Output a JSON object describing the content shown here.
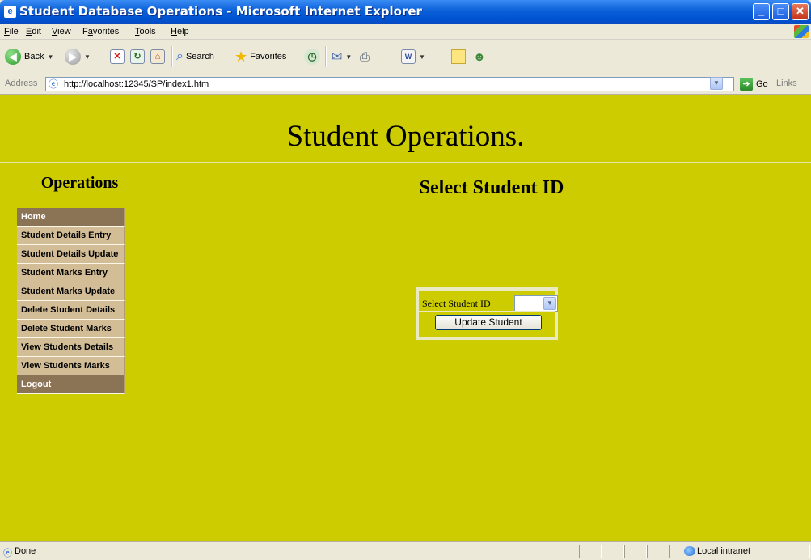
{
  "window": {
    "title": "Student Database Operations - Microsoft Internet Explorer",
    "controls": {
      "minimize": "_",
      "maximize": "□",
      "close": "X"
    }
  },
  "menu": [
    {
      "label": "File",
      "accel": "F",
      "rest": "ile"
    },
    {
      "label": "Edit",
      "accel": "E",
      "rest": "dit"
    },
    {
      "label": "View",
      "accel": "V",
      "rest": "iew"
    },
    {
      "label": "Favorites",
      "accel": "a",
      "pre": "F",
      "rest": "vorites"
    },
    {
      "label": "Tools",
      "accel": "T",
      "rest": "ools"
    },
    {
      "label": "Help",
      "accel": "H",
      "rest": "elp"
    }
  ],
  "toolbar": {
    "back_label": "Back",
    "search_label": "Search",
    "favorites_label": "Favorites"
  },
  "address": {
    "label": "Address",
    "url": "http://localhost:12345/SP/index1.htm",
    "go_label": "Go",
    "links_label": "Links"
  },
  "page": {
    "title": "Student Operations.",
    "sidebar_title": "Operations",
    "nav": [
      {
        "label": "Home",
        "style": "dark"
      },
      {
        "label": "Student Details Entry",
        "style": "light"
      },
      {
        "label": "Student Details Update",
        "style": "light"
      },
      {
        "label": "Student Marks Entry",
        "style": "light"
      },
      {
        "label": "Student Marks Update",
        "style": "light"
      },
      {
        "label": "Delete Student Details",
        "style": "light"
      },
      {
        "label": "Delete Student Marks",
        "style": "light"
      },
      {
        "label": "View Students Details",
        "style": "light"
      },
      {
        "label": "View Students Marks",
        "style": "light"
      },
      {
        "label": "Logout",
        "style": "dark"
      }
    ],
    "heading": "Select Student ID",
    "form": {
      "select_label": "Select Student ID",
      "select_value": "",
      "button_label": "Update Student"
    }
  },
  "status": {
    "text": "Done",
    "zone": "Local intranet"
  },
  "colors": {
    "page_background": "#CCCC00",
    "nav_dark": "#8B7355",
    "nav_light": "#D2BD96"
  }
}
